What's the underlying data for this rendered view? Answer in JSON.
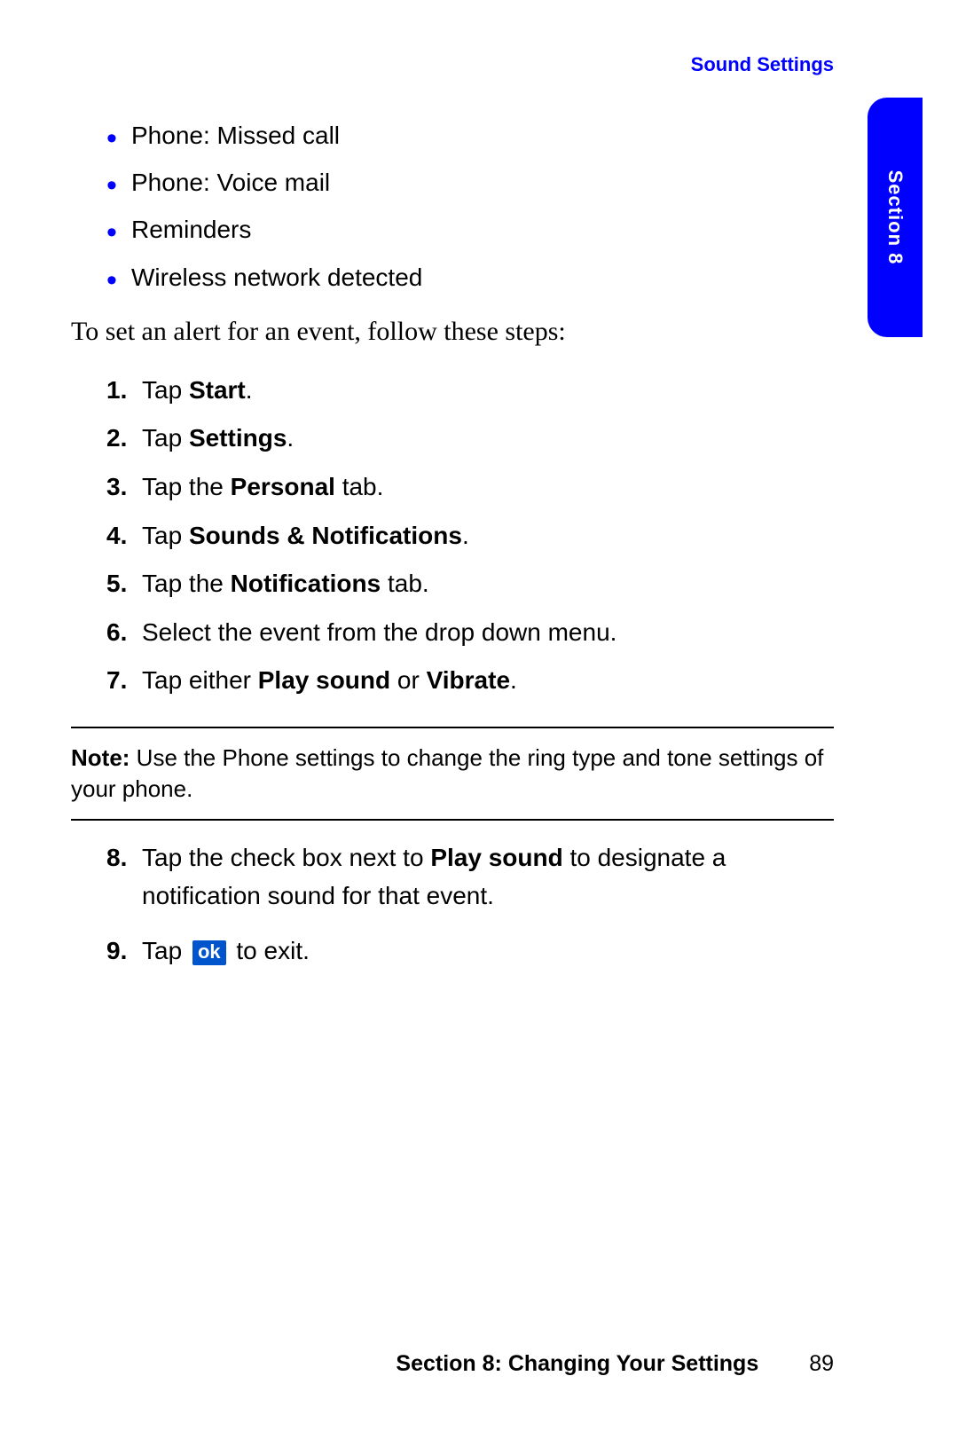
{
  "header": {
    "breadcrumb": "Sound Settings"
  },
  "tab": {
    "label": "Section 8"
  },
  "bullets": [
    "Phone: Missed call",
    "Phone: Voice mail",
    "Reminders",
    "Wireless network detected"
  ],
  "intro": "To set an alert for an event, follow these steps:",
  "steps": [
    {
      "n": "1.",
      "pre": "Tap ",
      "bold": "Start",
      "post": "."
    },
    {
      "n": "2.",
      "pre": "Tap ",
      "bold": "Settings",
      "post": "."
    },
    {
      "n": "3.",
      "pre": "Tap the ",
      "bold": "Personal",
      "post": " tab."
    },
    {
      "n": "4.",
      "pre": "Tap ",
      "bold": "Sounds & Notifications",
      "post": "."
    },
    {
      "n": "5.",
      "pre": "Tap the ",
      "bold": "Notifications",
      "post": " tab."
    },
    {
      "n": "6.",
      "pre": "Select the event from the drop down menu.",
      "bold": "",
      "post": ""
    },
    {
      "n": "7.",
      "pre": "Tap either ",
      "bold": "Play sound",
      "post": " or ",
      "bold2": "Vibrate",
      "post2": "."
    }
  ],
  "note": {
    "label": "Note:",
    "text": " Use the Phone settings to change the ring type and tone settings of your phone."
  },
  "steps2": [
    {
      "n": "8.",
      "pre": "Tap the check box next to ",
      "bold": "Play sound",
      "post": " to designate a notification sound for that event."
    },
    {
      "n": "9.",
      "pre": "Tap ",
      "ok": "ok",
      "post": " to exit."
    }
  ],
  "footer": {
    "section": "Section 8: Changing Your Settings",
    "page": "89"
  }
}
